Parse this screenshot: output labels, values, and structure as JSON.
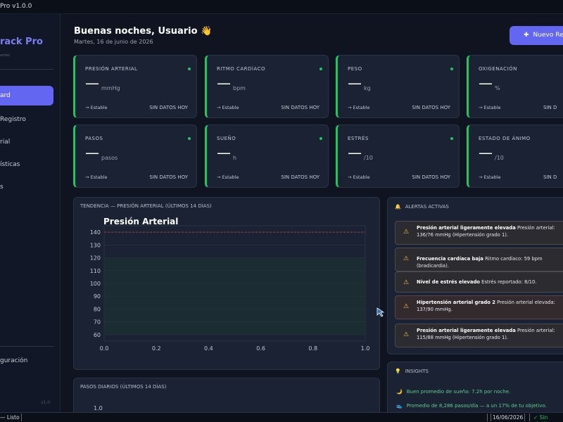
{
  "window": {
    "title": "Pro v1.0.0"
  },
  "sidebar": {
    "brand": "rack Pro",
    "brand_sub": "antes",
    "items": [
      {
        "label": "ard",
        "active": true
      },
      {
        "label": "Registro",
        "active": false
      },
      {
        "label": "rial",
        "active": false
      },
      {
        "label": "ísticas",
        "active": false
      },
      {
        "label": "s",
        "active": false
      }
    ],
    "config_label": "guración",
    "version": "v1.0"
  },
  "header": {
    "greeting": "Buenas noches, Usuario",
    "wave_icon": "👋",
    "date": "Martes, 16 de junio de 2026",
    "new_button": "Nuevo Regi"
  },
  "metrics": [
    {
      "label": "PRESIÓN ARTERIAL",
      "value": "—",
      "unit": "mmHg",
      "trend": "→ Estable",
      "status": "SIN DATOS HOY",
      "dot": true
    },
    {
      "label": "RITMO CARDÍACO",
      "value": "—",
      "unit": "bpm",
      "trend": "→ Estable",
      "status": "SIN DATOS HOY",
      "dot": true
    },
    {
      "label": "PESO",
      "value": "—",
      "unit": "kg",
      "trend": "→ Estable",
      "status": "SIN DATOS HOY",
      "dot": true
    },
    {
      "label": "OXIGENACIÓN",
      "value": "—",
      "unit": "%",
      "trend": "→ Estable",
      "status": "SIN D",
      "dot": false
    },
    {
      "label": "PASOS",
      "value": "—",
      "unit": "pasos",
      "trend": "→ Estable",
      "status": "SIN DATOS HOY",
      "dot": true
    },
    {
      "label": "SUEÑO",
      "value": "—",
      "unit": "h",
      "trend": "→ Estable",
      "status": "SIN DATOS HOY",
      "dot": true
    },
    {
      "label": "ESTRÉS",
      "value": "—",
      "unit": "/10",
      "trend": "→ Estable",
      "status": "SIN DATOS HOY",
      "dot": true
    },
    {
      "label": "ESTADO DE ÁNIMO",
      "value": "—",
      "unit": "/10",
      "trend": "→ Estable",
      "status": "SIN D",
      "dot": false
    }
  ],
  "trend_panel": {
    "title": "TENDENCIA — PRESIÓN ARTERIAL (ÚLTIMOS 14 DÍAS)"
  },
  "chart_data": {
    "type": "line",
    "title": "Presión Arterial",
    "series": [],
    "xlim": [
      0.0,
      1.0
    ],
    "ylim": [
      55,
      145
    ],
    "xticks": [
      "0.0",
      "0.2",
      "0.4",
      "0.6",
      "0.8",
      "1.0"
    ],
    "yticks": [
      "60",
      "70",
      "80",
      "90",
      "100",
      "110",
      "120",
      "130",
      "140"
    ],
    "reference_line": {
      "y": 140,
      "color": "#b04040",
      "style": "dashed"
    },
    "normal_band": [
      60,
      120
    ],
    "grid": true
  },
  "steps_panel": {
    "title": "PASOS DIARIOS (ÚLTIMOS 14 DÍAS)",
    "first_ytick": "1.0"
  },
  "alerts": {
    "title": "ALERTAS ACTIVAS",
    "items": [
      {
        "bold": "Presión arterial ligeramente elevada",
        "text": "Presión arterial: 136/76 mmHg (Hipertensión grado 1)."
      },
      {
        "bold": "Frecuencia cardíaca baja",
        "text": "Ritmo cardíaco: 59 bpm (bradicardia)."
      },
      {
        "bold": "Nivel de estrés elevado",
        "text": "Estrés reportado: 8/10."
      },
      {
        "bold": "Hipertensión arterial grado 2",
        "text": "Presión arterial elevada: 137/90 mmHg."
      },
      {
        "bold": "Presión arterial ligeramente elevada",
        "text": "Presión arterial: 115/88 mmHg (Hipertensión grado 1)."
      }
    ]
  },
  "insights": {
    "title": "INSIGHTS",
    "items": [
      {
        "icon": "moon-icon",
        "glyph": "🌙",
        "text": "Buen promedio de sueño: 7.2h por noche."
      },
      {
        "icon": "shoe-icon",
        "glyph": "👟",
        "text": "Promedio de 8,286 pasos/día — a un 17% de tu objetivo."
      }
    ]
  },
  "statusbar": {
    "left": "— Listo",
    "date": "16/06/2026",
    "right": "✓ Sin alerta"
  },
  "colors": {
    "accent": "#6366f1",
    "ok": "#22c55e",
    "warn": "#f2c04c",
    "danger_line": "#b04040"
  }
}
